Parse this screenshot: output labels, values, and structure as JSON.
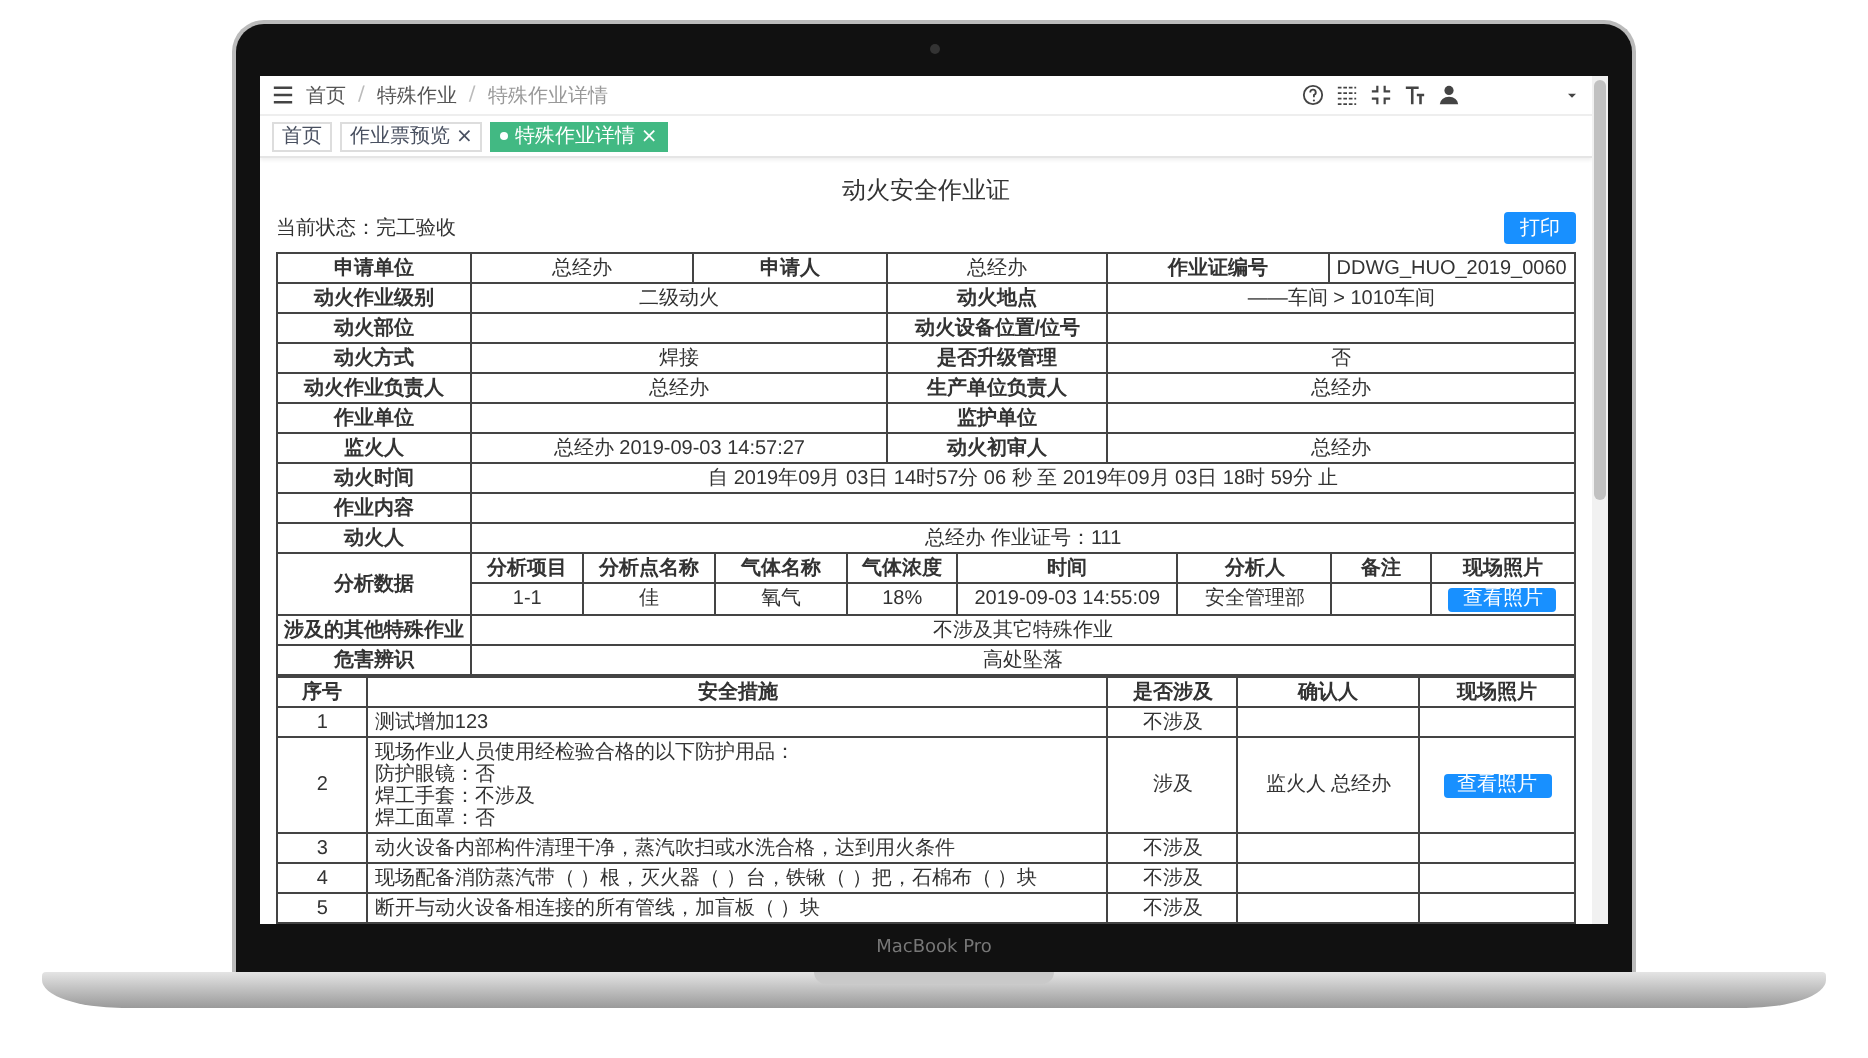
{
  "topbar": {
    "breadcrumb": [
      "首页",
      "特殊作业",
      "特殊作业详情"
    ],
    "separator": "/"
  },
  "tabs": [
    {
      "label": "首页",
      "selected": false
    },
    {
      "label": "作业票预览",
      "selected": false,
      "close": "×"
    },
    {
      "label": "特殊作业详情",
      "selected": true,
      "close": "×"
    }
  ],
  "page": {
    "title": "动火安全作业证",
    "status": "当前状态：完工验收",
    "print_button": "打印"
  },
  "info_rows": [
    {
      "kind": "triple",
      "pairs": [
        {
          "label": "申请单位",
          "value": "总经办"
        },
        {
          "label": "申请人",
          "value": "总经办"
        },
        {
          "label": "作业证编号",
          "value": "DDWG_HUO_2019_0060"
        }
      ]
    },
    {
      "kind": "double",
      "pairs": [
        {
          "label": "动火作业级别",
          "value": "二级动火"
        },
        {
          "label": "动火地点",
          "value": "——车间 > 1010车间"
        }
      ]
    },
    {
      "kind": "double",
      "pairs": [
        {
          "label": "动火部位"
        },
        {
          "label": "动火设备位置/位号"
        }
      ]
    },
    {
      "kind": "double",
      "pairs": [
        {
          "label": "动火方式",
          "value": "焊接"
        },
        {
          "label": "是否升级管理",
          "value": "否"
        }
      ]
    },
    {
      "kind": "double",
      "pairs": [
        {
          "label": "动火作业负责人",
          "value": "总经办"
        },
        {
          "label": "生产单位负责人",
          "value": "总经办"
        }
      ]
    },
    {
      "kind": "double",
      "pairs": [
        {
          "label": "作业单位"
        },
        {
          "label": "监护单位"
        }
      ]
    },
    {
      "kind": "double",
      "pairs": [
        {
          "label": "监火人",
          "value": "总经办  2019-09-03 14:57:27"
        },
        {
          "label": "动火初审人",
          "value": "总经办"
        }
      ]
    },
    {
      "kind": "single",
      "pairs": [
        {
          "label": "动火时间",
          "value": "自 2019年09月 03日 14时57分 06 秒 至 2019年09月 03日 18时 59分 止"
        }
      ]
    },
    {
      "kind": "single",
      "pairs": [
        {
          "label": "作业内容"
        }
      ]
    },
    {
      "kind": "single",
      "pairs": [
        {
          "label": "动火人",
          "value": "总经办  作业证号：111"
        }
      ]
    },
    {
      "kind": "analysis",
      "label": "分析数据",
      "columns": [
        "分析项目",
        "分析点名称",
        "气体名称",
        "气体浓度",
        "时间",
        "分析人",
        "备注",
        "现场照片"
      ],
      "rows": [
        {
          "item": "1-1",
          "point": "佳",
          "gas": "氧气",
          "concentration": "18%",
          "time": "2019-09-03 14:55:09",
          "analyst": "安全管理部",
          "photo_button": "查看照片"
        }
      ]
    },
    {
      "kind": "single",
      "pairs": [
        {
          "label": "涉及的其他特殊作业",
          "value": "不涉及其它特殊作业"
        }
      ]
    },
    {
      "kind": "single",
      "pairs": [
        {
          "label": "危害辨识",
          "value": "高处坠落"
        }
      ]
    }
  ],
  "measures": {
    "columns": [
      "序号",
      "安全措施",
      "是否涉及",
      "确认人",
      "现场照片"
    ],
    "rows": [
      {
        "no": "1",
        "text": "测试增加123",
        "involved": "不涉及"
      },
      {
        "no": "2",
        "lines": [
          "现场作业人员使用经检验合格的以下防护用品：",
          "防护眼镜：否",
          "焊工手套：不涉及",
          "焊工面罩：否"
        ],
        "involved": "涉及",
        "confirmer": "监火人  总经办",
        "photo_button": "查看照片"
      },
      {
        "no": "3",
        "text": "动火设备内部构件清理干净，蒸汽吹扫或水洗合格，达到用火条件",
        "involved": "不涉及"
      },
      {
        "no": "4",
        "text": "现场配备消防蒸汽带（ ）根，灭火器（ ）台，铁锹（ ）把，石棉布（ ）块",
        "involved": "不涉及"
      },
      {
        "no": "5",
        "text": "断开与动火设备相连接的所有管线，加盲板（ ）块",
        "involved": "不涉及"
      }
    ]
  },
  "device": {
    "brand_label": "MacBook Pro"
  }
}
